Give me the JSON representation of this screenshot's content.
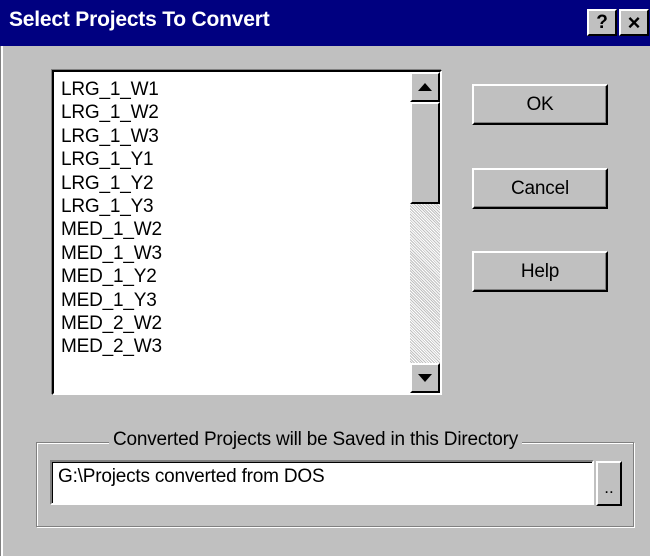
{
  "window": {
    "title": "Select Projects To Convert",
    "help_button": "?",
    "close_button": "×"
  },
  "project_list": {
    "items": [
      "LRG_1_W1",
      "LRG_1_W2",
      "LRG_1_W3",
      "LRG_1_Y1",
      "LRG_1_Y2",
      "LRG_1_Y3",
      "MED_1_W2",
      "MED_1_W3",
      "MED_1_Y2",
      "MED_1_Y3",
      "MED_2_W2",
      "MED_2_W3"
    ]
  },
  "buttons": {
    "ok": "OK",
    "cancel": "Cancel",
    "help": "Help"
  },
  "directory": {
    "group_label": "Converted Projects will be Saved in this Directory",
    "value": "G:\\Projects converted from DOS",
    "browse_label": ".."
  },
  "colors": {
    "title_bar": "#000080",
    "face": "#c0c0c0",
    "window_bg": "#ffffff"
  }
}
